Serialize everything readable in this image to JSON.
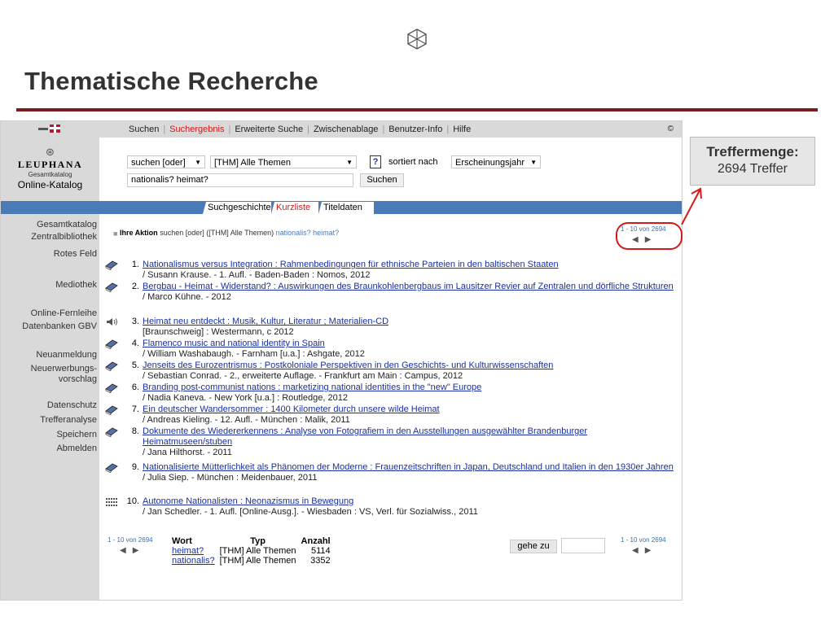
{
  "slide": {
    "title": "Thematische Recherche"
  },
  "topnav": {
    "items": [
      "Suchen",
      "Suchergebnis",
      "Erweiterte Suche",
      "Zwischenablage",
      "Benutzer-Info",
      "Hilfe"
    ],
    "copyright": "©"
  },
  "brand": {
    "name": "LEUPHANA",
    "sub": "Gesamtkatalog",
    "catalog": "Online-Katalog"
  },
  "search": {
    "mode": "suchen [oder]",
    "field": "[THM] Alle Themen",
    "help": "?",
    "sort_label": "sortiert nach",
    "sort_value": "Erscheinungsjahr",
    "query": "nationalis? heimat?",
    "button": "Suchen"
  },
  "tabs": [
    "Suchgeschichte",
    "Kurzliste",
    "Titeldaten"
  ],
  "sidebar": {
    "items": [
      "Gesamtkatalog",
      "Zentralbibliothek",
      "Rotes Feld",
      "Mediothek",
      "Online-Fernleihe",
      "Datenbanken GBV",
      "Neuanmeldung",
      "Neuerwerbungs-",
      "vorschlag",
      "Datenschutz",
      "Trefferanalyse",
      "Speichern",
      "Abmelden"
    ]
  },
  "action": {
    "label": "Ihre Aktion",
    "text": "suchen [oder] ([THM] Alle Themen)",
    "query": "nationalis? heimat?"
  },
  "pager": {
    "range": "1 - 10 von 2694",
    "prev": "◀",
    "next": "▶"
  },
  "results": [
    {
      "num": "1.",
      "icon": "book-icon",
      "title": "Nationalismus versus Integration : Rahmenbedingungen für ethnische Parteien in den baltischen Staaten",
      "details": "/ Susann Krause. - 1. Aufl. - Baden-Baden : Nomos, 2012"
    },
    {
      "num": "2.",
      "icon": "book-icon",
      "title": "Bergbau - Heimat - Widerstand? : Auswirkungen des Braunkohlenbergbaus im Lausitzer Revier auf Zentralen und dörfliche Strukturen",
      "details": "/ Marco Kühne. - 2012"
    },
    {
      "num": "3.",
      "icon": "audio-icon",
      "title": "Heimat neu entdeckt : Musik, Kultur, Literatur ; Materialien-CD",
      "details": "[Braunschweig] : Westermann, c 2012"
    },
    {
      "num": "4.",
      "icon": "book-icon",
      "title": "Flamenco music and national identity in Spain",
      "details": "/ William Washabaugh. - Farnham [u.a.] : Ashgate, 2012"
    },
    {
      "num": "5.",
      "icon": "book-icon",
      "title": "Jenseits des Eurozentrismus : Postkoloniale Perspektiven in den Geschichts- und Kulturwissenschaften",
      "details": "/ Sebastian Conrad. - 2., erweiterte Auflage. - Frankfurt am Main : Campus, 2012"
    },
    {
      "num": "6.",
      "icon": "book-icon",
      "title": "Branding post-communist nations : marketizing national identities in the \"new\" Europe",
      "details": "/ Nadia Kaneva. - New York [u.a.] : Routledge, 2012"
    },
    {
      "num": "7.",
      "icon": "book-icon",
      "title": "Ein deutscher Wandersommer : 1400 Kilometer durch unsere wilde Heimat",
      "details": "/ Andreas Kieling. - 12. Aufl. - München : Malik, 2011"
    },
    {
      "num": "8.",
      "icon": "book-icon",
      "title": "Dokumente des Wiedererkennens : Analyse von Fotografiem in den Ausstellungen ausgewählter Brandenburger Heimatmuseen/stuben",
      "details": "/ Jana Hilthorst. - 2011"
    },
    {
      "num": "9.",
      "icon": "book-icon",
      "title": "Nationalisierte Mütterlichkeit als Phänomen der Moderne : Frauenzeitschriften in Japan, Deutschland und Italien in den 1930er Jahren",
      "details": "/ Julia Siep. - München : Meidenbauer, 2011"
    },
    {
      "num": "10.",
      "icon": "online-resource-icon",
      "title": "Autonome Nationalisten : Neonazismus in Bewegung",
      "details": "/ Jan Schedler. - 1. Aufl. [Online-Ausg.]. - Wiesbaden : VS, Verl. für Sozialwiss., 2011"
    }
  ],
  "word_table": {
    "headers": [
      "Wort",
      "Typ",
      "Anzahl"
    ],
    "rows": [
      {
        "word": "heimat?",
        "type": "[THM] Alle Themen",
        "count": "5114"
      },
      {
        "word": "nationalis?",
        "type": "[THM] Alle Themen",
        "count": "3352"
      }
    ]
  },
  "goto": {
    "label": "gehe zu",
    "value": ""
  },
  "callout": {
    "title": "Treffermenge:",
    "value": "2694 Treffer"
  },
  "colors": {
    "accent_red": "#d21a1a",
    "bar_blue": "#4a7ab8",
    "title_rule": "#7a1d22"
  }
}
